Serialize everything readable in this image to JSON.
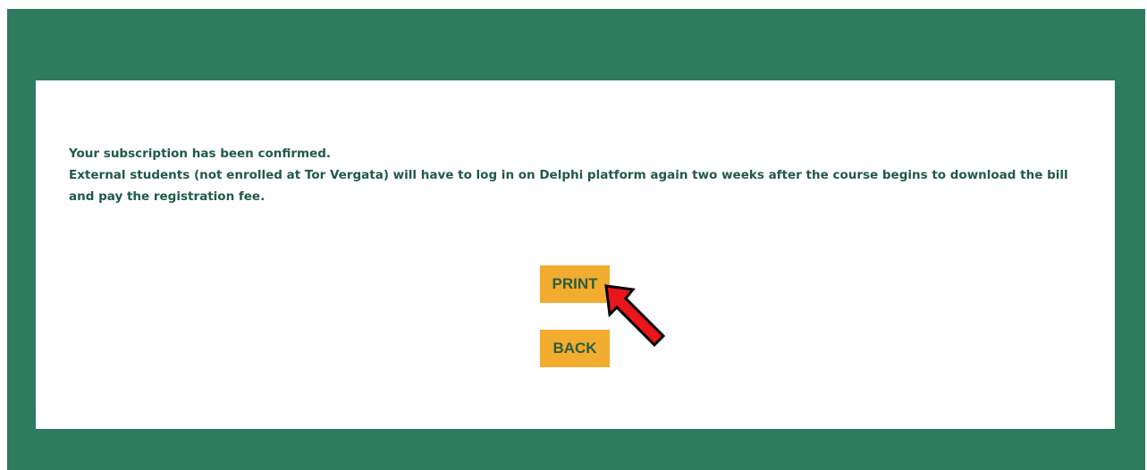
{
  "message": {
    "line1": "Your subscription has been confirmed.",
    "line2": "External students (not enrolled at Tor Vergata) will have to log in on Delphi platform again two weeks after the course begins to download the bill and pay the registration fee."
  },
  "buttons": {
    "print_label": "PRINT",
    "back_label": "BACK"
  },
  "annotation": {
    "pointer_icon": "red-arrow-icon",
    "pointer_color": "#e8151b"
  },
  "colors": {
    "frame": "#2e7b5e",
    "panel": "#ffffff",
    "text": "#1f5a47",
    "button": "#f2ac2f",
    "button_text": "#2c5e3b"
  }
}
